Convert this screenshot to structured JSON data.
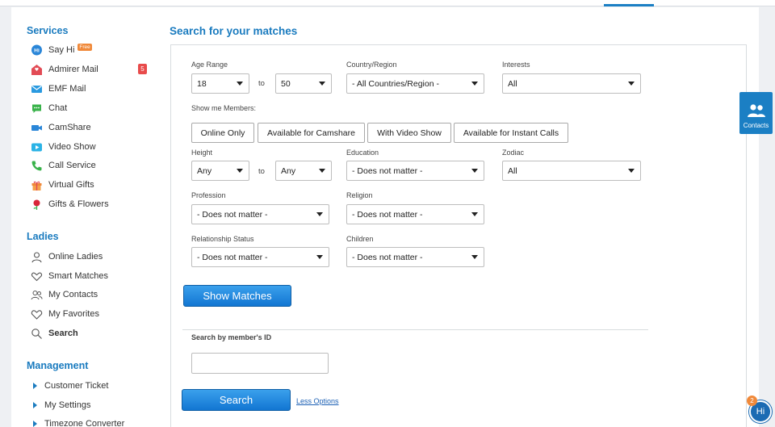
{
  "sidebar": {
    "services_title": "Services",
    "services": [
      {
        "label": "Say Hi",
        "badge": "Free"
      },
      {
        "label": "Admirer Mail",
        "count": "5"
      },
      {
        "label": "EMF Mail"
      },
      {
        "label": "Chat"
      },
      {
        "label": "CamShare"
      },
      {
        "label": "Video Show"
      },
      {
        "label": "Call Service"
      },
      {
        "label": "Virtual Gifts"
      },
      {
        "label": "Gifts & Flowers"
      }
    ],
    "ladies_title": "Ladies",
    "ladies": [
      {
        "label": "Online Ladies"
      },
      {
        "label": "Smart Matches"
      },
      {
        "label": "My Contacts"
      },
      {
        "label": "My Favorites"
      },
      {
        "label": "Search"
      }
    ],
    "management_title": "Management",
    "management": [
      {
        "label": "Customer Ticket"
      },
      {
        "label": "My Settings"
      },
      {
        "label": "Timezone Converter"
      }
    ]
  },
  "main": {
    "title": "Search for your matches",
    "age_range": {
      "label": "Age Range",
      "from": "18",
      "to_label": "to",
      "to": "50"
    },
    "country": {
      "label": "Country/Region",
      "value": "- All Countries/Region -"
    },
    "interests": {
      "label": "Interests",
      "value": "All"
    },
    "show_members": {
      "label": "Show me Members:",
      "options": [
        "Online Only",
        "Available for Camshare",
        "With Video Show",
        "Available for Instant Calls"
      ]
    },
    "height": {
      "label": "Height",
      "from": "Any",
      "to_label": "to",
      "to": "Any"
    },
    "education": {
      "label": "Education",
      "value": "- Does not matter -"
    },
    "zodiac": {
      "label": "Zodiac",
      "value": "All"
    },
    "profession": {
      "label": "Profession",
      "value": "- Does not matter -"
    },
    "religion": {
      "label": "Religion",
      "value": "- Does not matter -"
    },
    "relationship": {
      "label": "Relationship Status",
      "value": "- Does not matter -"
    },
    "children": {
      "label": "Children",
      "value": "- Does not matter -"
    },
    "show_matches": "Show Matches",
    "member_id": {
      "label": "Search by member's ID",
      "value": ""
    },
    "search_button": "Search",
    "less_options": "Less Options"
  },
  "contacts_widget": {
    "label": "Contacts"
  },
  "chat_widget": {
    "label": "Hi",
    "count": "2"
  },
  "colors": {
    "accent": "#1a7bbf",
    "button": "#1276d2",
    "badge": "#e84b4b",
    "free": "#f0893a"
  }
}
